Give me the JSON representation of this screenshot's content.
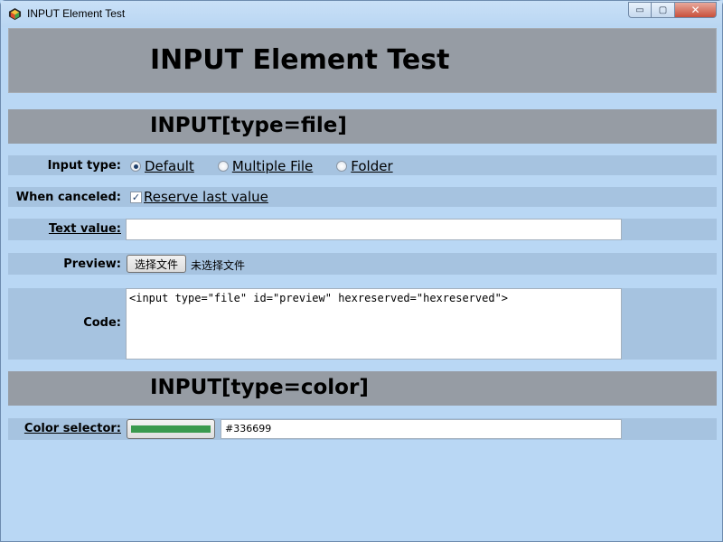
{
  "window": {
    "title": "INPUT Element Test",
    "controls": {
      "minimize": "▭",
      "maximize": "▢",
      "close": "✕"
    }
  },
  "page": {
    "heading": "INPUT Element Test"
  },
  "file_section": {
    "heading": "INPUT[type=file]",
    "input_type": {
      "label": "Input type:",
      "options": [
        {
          "label": "Default",
          "selected": true
        },
        {
          "label": "Multiple File",
          "selected": false
        },
        {
          "label": "Folder",
          "selected": false
        }
      ]
    },
    "when_canceled": {
      "label": "When canceled:",
      "checkbox_label": "Reserve last value",
      "checked": true
    },
    "text_value": {
      "label": "Text value:",
      "value": ""
    },
    "preview": {
      "label": "Preview:",
      "button_label": "选择文件",
      "status": "未选择文件"
    },
    "code": {
      "label": "Code:",
      "value": "<input type=\"file\" id=\"preview\" hexreserved=\"hexreserved\">"
    }
  },
  "color_section": {
    "heading": "INPUT[type=color]",
    "color_selector": {
      "label": "Color selector:",
      "swatch_color": "#3a9a4e",
      "value": "#336699"
    }
  }
}
